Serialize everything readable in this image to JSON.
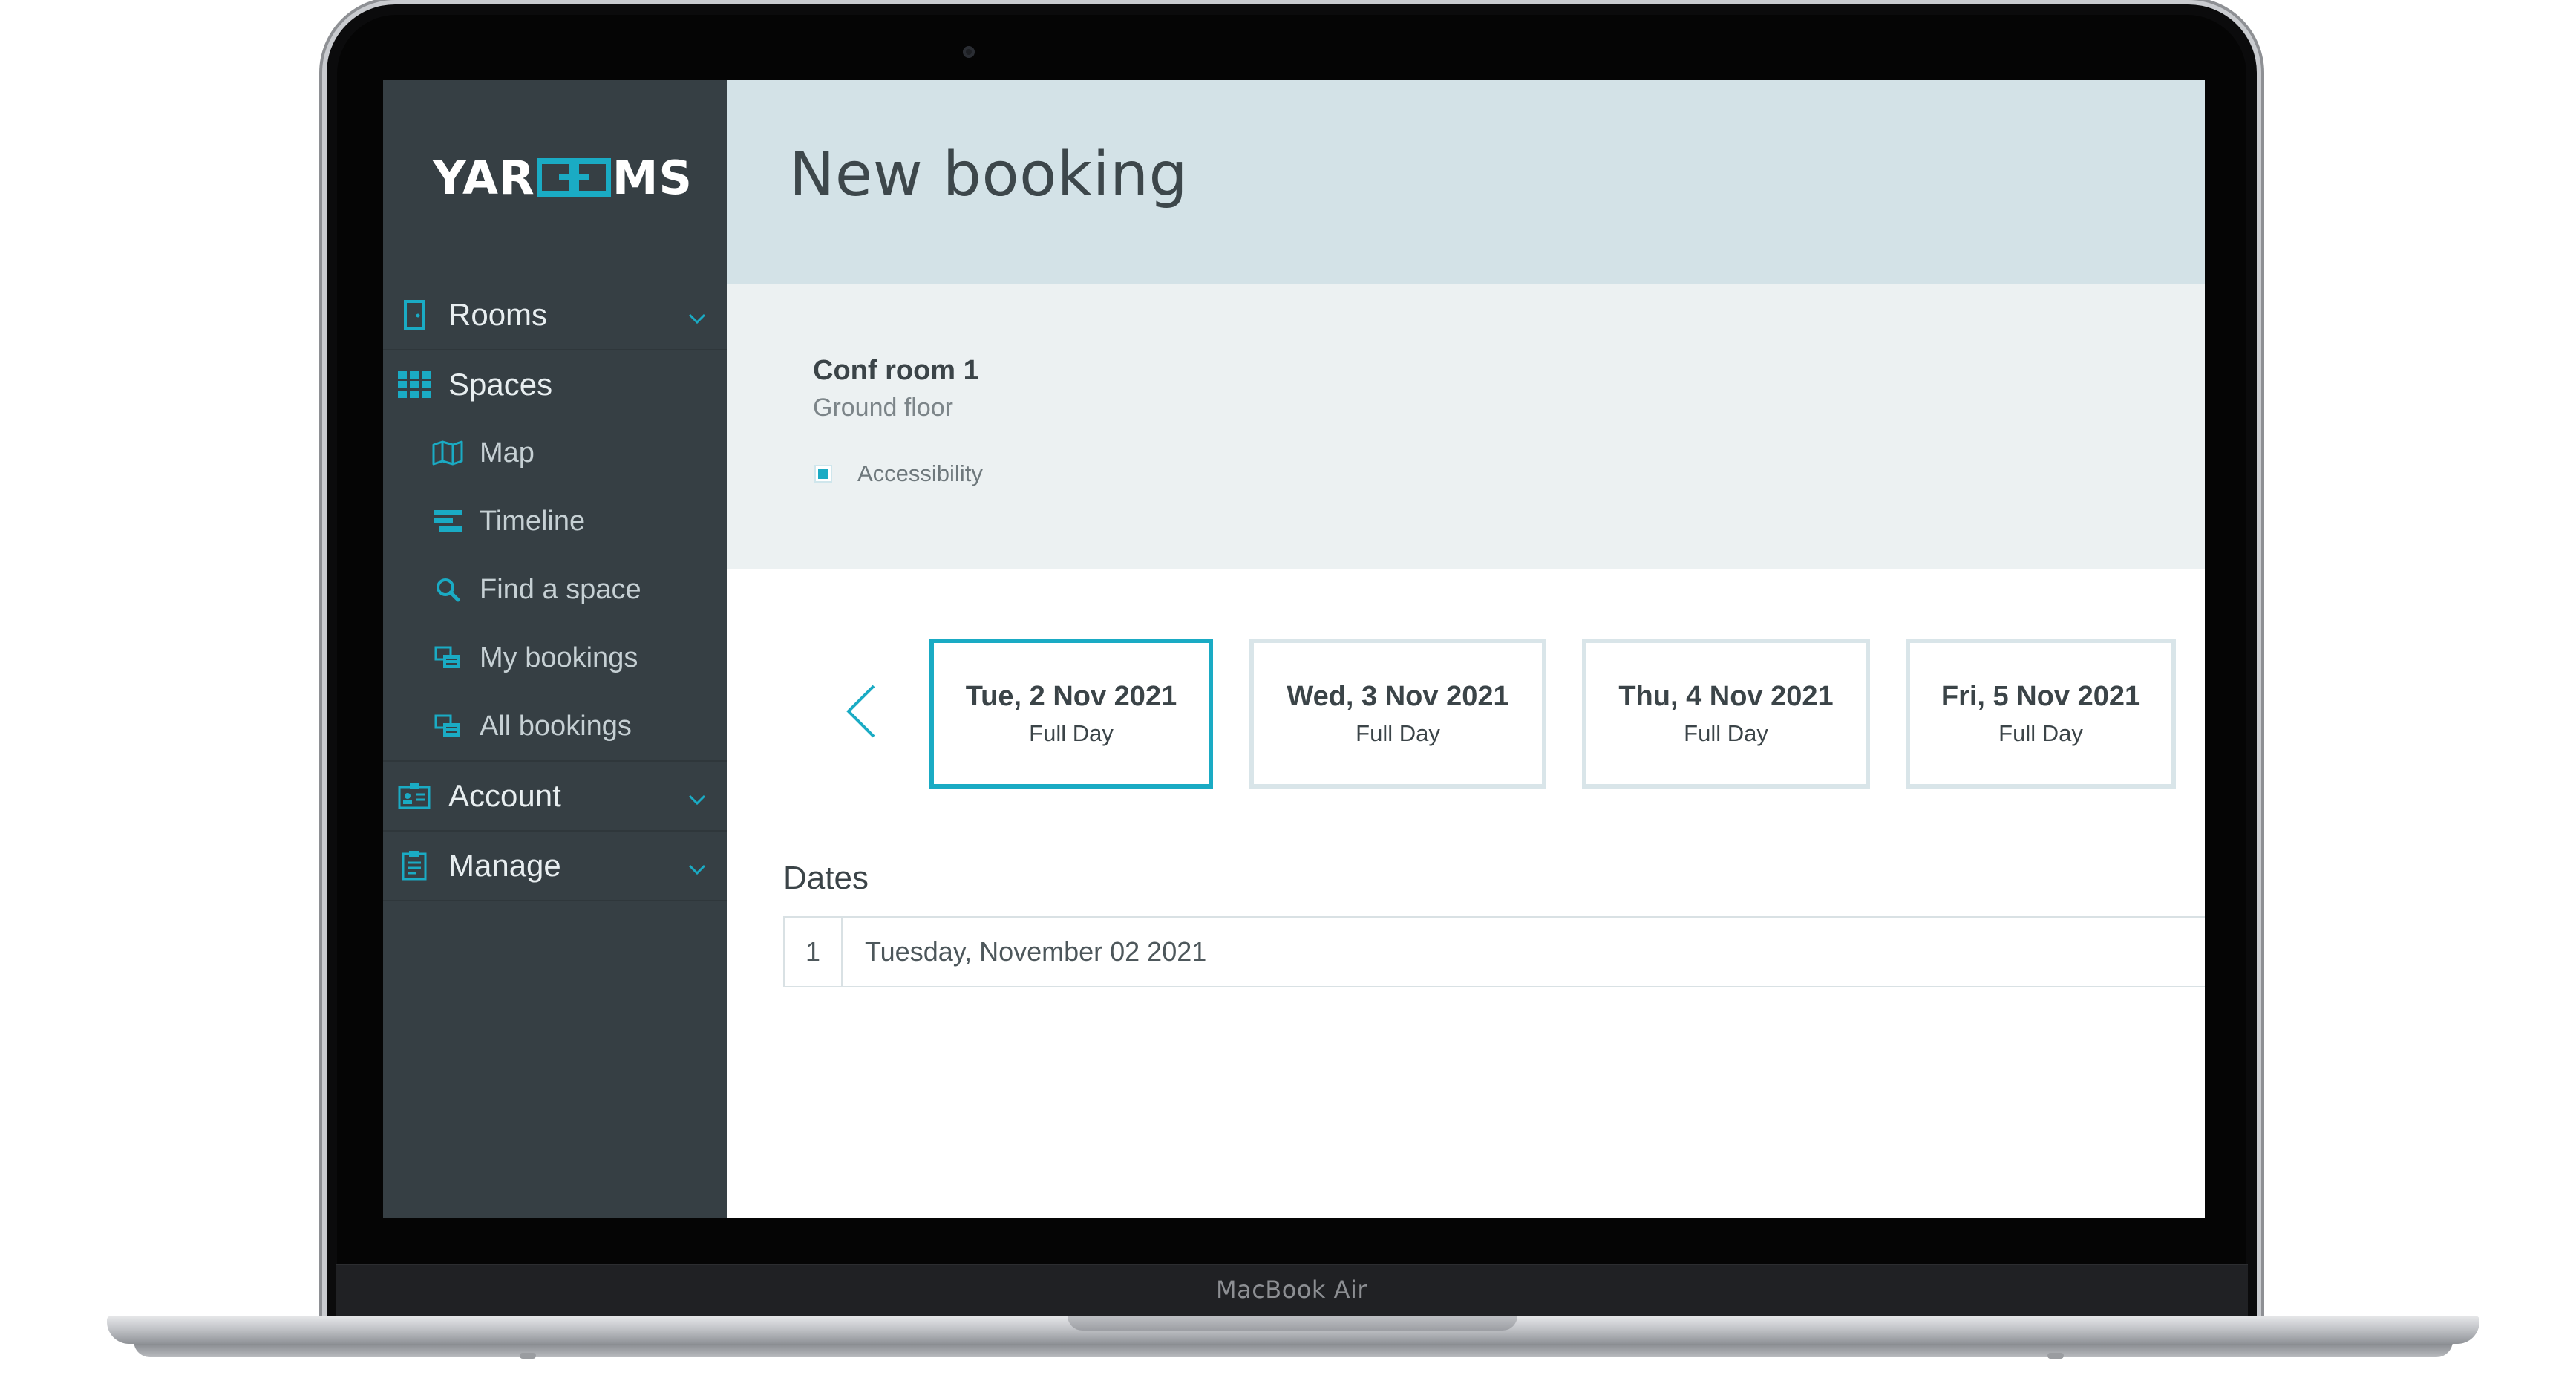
{
  "device": {
    "label": "MacBook Air"
  },
  "brand": {
    "logo_left": "YAR",
    "logo_right": "MS",
    "accent": "#1aabc4"
  },
  "sidebar": {
    "items": [
      {
        "label": "Rooms",
        "icon": "door-icon",
        "expandable": true
      },
      {
        "label": "Spaces",
        "icon": "grid-icon",
        "expandable": false
      },
      {
        "label": "Map",
        "icon": "map-icon",
        "sub": true
      },
      {
        "label": "Timeline",
        "icon": "timeline-icon",
        "sub": true
      },
      {
        "label": "Find a space",
        "icon": "search-icon",
        "sub": true
      },
      {
        "label": "My bookings",
        "icon": "bookings-icon",
        "sub": true
      },
      {
        "label": "All bookings",
        "icon": "bookings-icon",
        "sub": true
      },
      {
        "label": "Account",
        "icon": "id-card-icon",
        "expandable": true
      },
      {
        "label": "Manage",
        "icon": "clipboard-icon",
        "expandable": true
      }
    ]
  },
  "header": {
    "title": "New booking"
  },
  "room": {
    "name": "Conf room 1",
    "floor": "Ground floor",
    "features": [
      "Accessibility"
    ]
  },
  "date_cards": [
    {
      "date": "Tue, 2 Nov 2021",
      "type": "Full Day",
      "selected": true
    },
    {
      "date": "Wed, 3 Nov 2021",
      "type": "Full Day",
      "selected": false
    },
    {
      "date": "Thu, 4 Nov 2021",
      "type": "Full Day",
      "selected": false
    },
    {
      "date": "Fri, 5 Nov 2021",
      "type": "Full Day",
      "selected": false
    }
  ],
  "dates": {
    "heading": "Dates",
    "rows": [
      {
        "index": "1",
        "value": "Tuesday, November 02 2021"
      }
    ]
  }
}
